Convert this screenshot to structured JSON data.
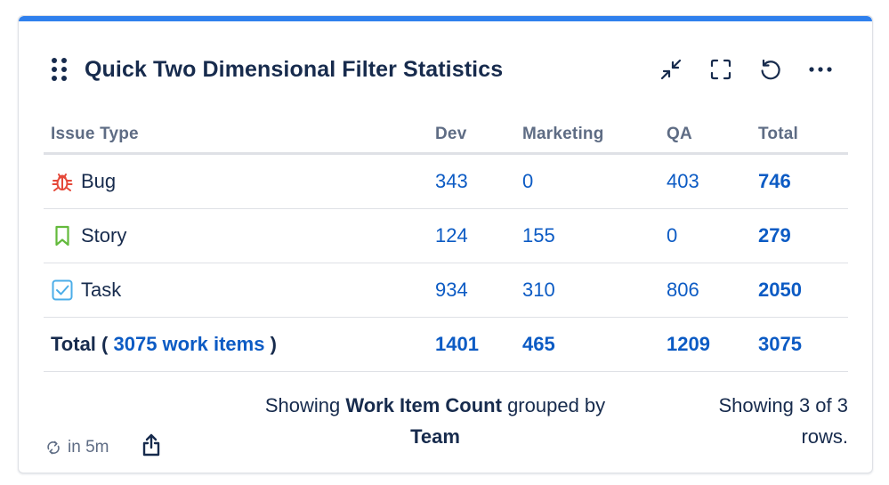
{
  "gadget": {
    "title": "Quick Two Dimensional Filter Statistics",
    "accent_color": "#2f80ed",
    "actions": [
      {
        "name": "minimize",
        "icon": "minimize-icon"
      },
      {
        "name": "fullscreen",
        "icon": "fullscreen-icon"
      },
      {
        "name": "refresh",
        "icon": "refresh-icon"
      },
      {
        "name": "more",
        "icon": "more-icon"
      }
    ]
  },
  "table": {
    "columns": [
      "Issue Type",
      "Dev",
      "Marketing",
      "QA",
      "Total"
    ],
    "rows": [
      {
        "type": "Bug",
        "icon": "bug-icon",
        "icon_color": "#e5493a",
        "dev": "343",
        "marketing": "0",
        "qa": "403",
        "total": "746"
      },
      {
        "type": "Story",
        "icon": "story-icon",
        "icon_color": "#63ba3c",
        "dev": "124",
        "marketing": "155",
        "qa": "0",
        "total": "279"
      },
      {
        "type": "Task",
        "icon": "task-icon",
        "icon_color": "#4bade8",
        "dev": "934",
        "marketing": "310",
        "qa": "806",
        "total": "2050"
      }
    ],
    "total_row": {
      "label_prefix": "Total (",
      "link": "3075 work items",
      "label_suffix": ")",
      "dev": "1401",
      "marketing": "465",
      "qa": "1209",
      "total": "3075"
    }
  },
  "footer": {
    "refresh_text": "in 5m",
    "summary_prefix": "Showing",
    "summary_stat": "Work Item Count",
    "summary_mid": "grouped by",
    "summary_group": "Team",
    "rows_info": "Showing 3 of 3 rows."
  }
}
